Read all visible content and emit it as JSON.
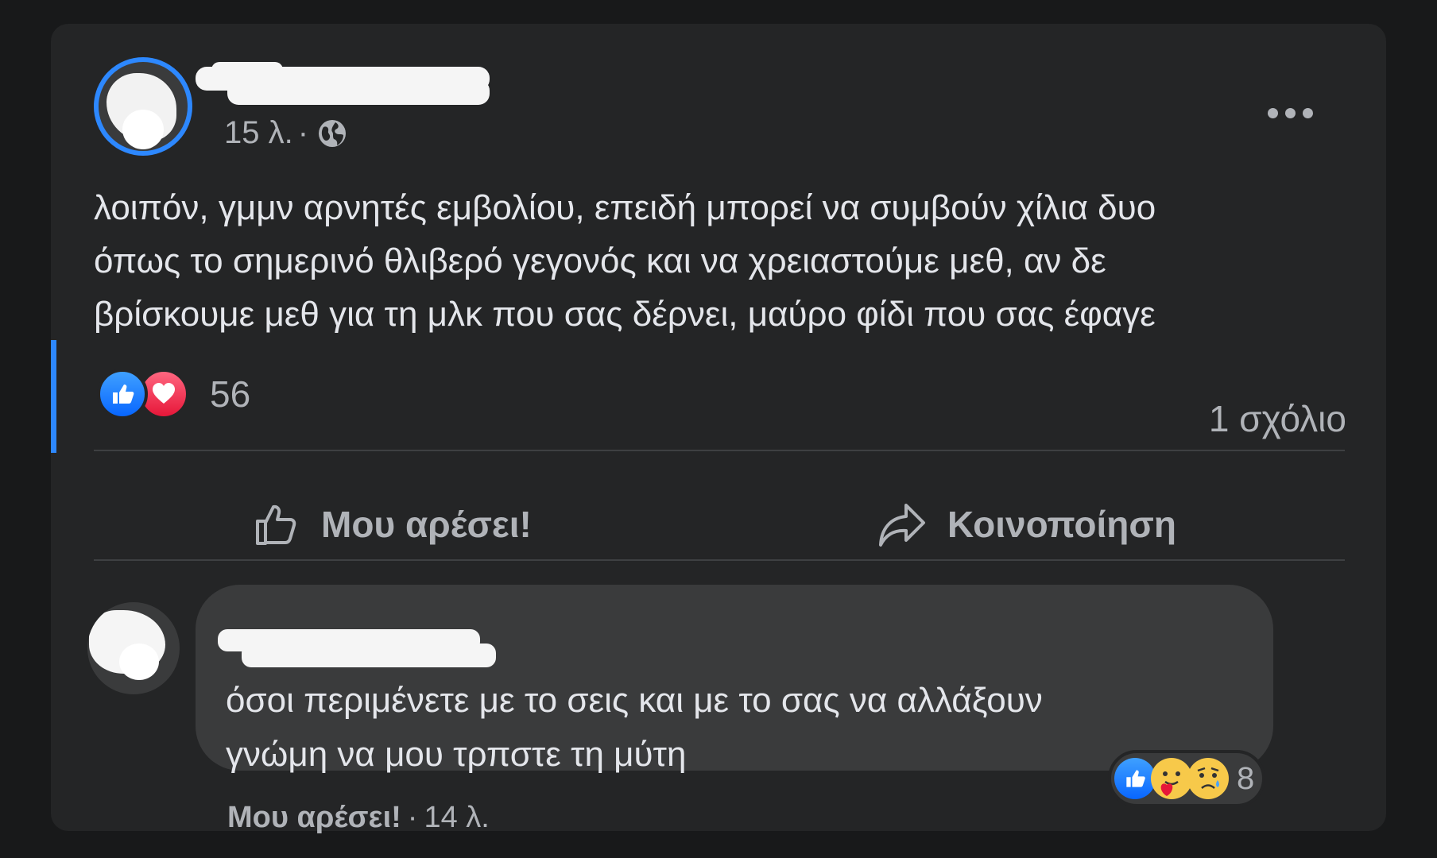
{
  "post": {
    "time": "15 λ.",
    "separator": "·",
    "privacy_icon": "globe-icon",
    "more_icon": "more-options-icon",
    "text_lines": [
      "λοιπόν, γμμν αρνητές εμβολίου, επειδή μπορεί να συμβούν χίλια δυο",
      "όπως το σημερινό θλιβερό γεγονός και να χρειαστούμε μεθ, αν δε",
      "βρίσκουμε μεθ για τη μλκ που σας δέρνει, μαύρο φίδι που σας έφαγε"
    ],
    "reaction_count": "56",
    "reaction_icons": [
      "like-reaction-icon",
      "love-reaction-icon"
    ],
    "comments_count": "1 σχόλιο"
  },
  "actions": {
    "like_label": "Μου αρέσει!",
    "share_label": "Κοινοποίηση"
  },
  "comment": {
    "text_lines": [
      "όσοι περιμένετε με το σεις και με το σας να αλλάξουν",
      "γνώμη να μου τρπστε τη μύτη"
    ],
    "reaction_count": "8",
    "reaction_icons": [
      "like-reaction-icon",
      "care-reaction-icon",
      "sad-reaction-icon"
    ],
    "like_label": "Μου αρέσει!",
    "separator": "·",
    "time": "14 λ."
  },
  "colors": {
    "background": "#18191a",
    "card": "#242526",
    "bubble": "#3a3b3c",
    "accent": "#2d88ff",
    "text": "#e4e6eb",
    "secondary_text": "#b0b3b8"
  }
}
